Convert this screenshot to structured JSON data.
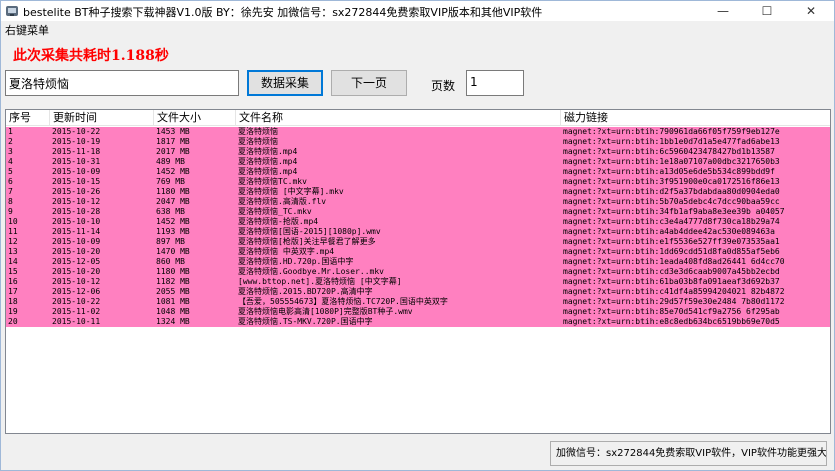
{
  "window": {
    "title": "bestelite BT种子搜索下载神器V1.0版  BY：徐先安    加微信号：sx272844免费索取VIP版本和其他VIP软件",
    "minimize_glyph": "—",
    "maximize_glyph": "☐",
    "close_glyph": "✕"
  },
  "menu": {
    "context_menu_label": "右键菜单"
  },
  "elapsed_text": "此次采集共耗时1.188秒",
  "search": {
    "value": "夏洛特烦恼"
  },
  "buttons": {
    "collect_label": "数据采集",
    "next_label": "下一页"
  },
  "page": {
    "label": "页数",
    "value": "1"
  },
  "table": {
    "row_color": "#ff80c0",
    "columns": [
      "序号",
      "更新时间",
      "文件大小",
      "文件名称",
      "磁力链接"
    ],
    "rows": [
      [
        "1",
        "2015-10-22",
        "1453 MB",
        "夏洛特烦恼",
        "magnet:?xt=urn:btih:790961da66f05f759f9eb127e"
      ],
      [
        "2",
        "2015-10-19",
        "1817 MB",
        "夏洛特烦恼",
        "magnet:?xt=urn:btih:1bb1e0d7d1a5e477fad6abe13"
      ],
      [
        "3",
        "2015-11-18",
        "2017 MB",
        "夏洛特烦恼.mp4",
        "magnet:?xt=urn:btih:6c5960423478427bd1b13587"
      ],
      [
        "4",
        "2015-10-31",
        "489 MB",
        "夏洛特烦恼.mp4",
        "magnet:?xt=urn:btih:1e18a07107a00dbc3217650b3"
      ],
      [
        "5",
        "2015-10-09",
        "1452 MB",
        "夏洛特烦恼.mp4",
        "magnet:?xt=urn:btih:a13d05e6de5b534c899bdd9f"
      ],
      [
        "6",
        "2015-10-15",
        "769 MB",
        "夏洛特烦恼TC.mkv",
        "magnet:?xt=urn:btih:3f951900e0ca0172516f86e13"
      ],
      [
        "7",
        "2015-10-26",
        "1180 MB",
        "夏洛特烦恼 [中文字幕].mkv",
        "magnet:?xt=urn:btih:d2f5a37bdabdaa80d0904eda0"
      ],
      [
        "8",
        "2015-10-12",
        "2047 MB",
        "夏洛特烦恼.高清版.flv",
        "magnet:?xt=urn:btih:5b70a5debc4c7dcc90baa59cc"
      ],
      [
        "9",
        "2015-10-28",
        "638 MB",
        "夏洛特烦恼_TC.mkv",
        "magnet:?xt=urn:btih:34fb1af9aba8e3ee39b a04057"
      ],
      [
        "10",
        "2015-10-10",
        "1452 MB",
        "夏洛特烦恼-抢版.mp4",
        "magnet:?xt=urn:btih:c3e4a4777d8f730ca18b29a74"
      ],
      [
        "11",
        "2015-11-14",
        "1193 MB",
        "夏洛特烦恼[国语-2015][1080p].wmv",
        "magnet:?xt=urn:btih:a4ab4ddee42ac530e089463a"
      ],
      [
        "12",
        "2015-10-09",
        "897 MB",
        "夏洛特烦恼[枪版]关注早餐君了解更多",
        "magnet:?xt=urn:btih:e1f5536e527ff39e073535aa1"
      ],
      [
        "13",
        "2015-10-20",
        "1470 MB",
        "夏洛特烦恼 中英双字.mp4",
        "magnet:?xt=urn:btih:1dd69cdd51d8fa0d855af5eb6"
      ],
      [
        "14",
        "2015-12-05",
        "860 MB",
        "夏洛特烦恼.HD.720p.国语中字",
        "magnet:?xt=urn:btih:1eada408fd8ad26441 6d4cc70"
      ],
      [
        "15",
        "2015-10-20",
        "1180 MB",
        "夏洛特烦恼.Goodbye.Mr.Loser..mkv",
        "magnet:?xt=urn:btih:cd3e3d6caab9007a45bb2ecbd"
      ],
      [
        "16",
        "2015-10-12",
        "1182 MB",
        "[www.bttop.net].夏洛特烦恼 [中文字幕]",
        "magnet:?xt=urn:btih:61ba03b8fa091aeaf3d692b37"
      ],
      [
        "17",
        "2015-12-06",
        "2055 MB",
        "夏洛特烦恼.2015.BD720P.高清中字",
        "magnet:?xt=urn:btih:c41df4a85994204021 82b4872"
      ],
      [
        "18",
        "2015-10-22",
        "1081 MB",
        "【吾爱，505554673】夏洛特烦恼.TC720P.国语中英双字",
        "magnet:?xt=urn:btih:29d57f59e30e2484 7b80d1172"
      ],
      [
        "19",
        "2015-11-02",
        "1048 MB",
        "夏洛特烦恼电影高清[1080P]完整版BT种子.wmv",
        "magnet:?xt=urn:btih:85e70d541cf9a2756 6f295ab"
      ],
      [
        "20",
        "2015-10-11",
        "1324 MB",
        "夏洛特烦恼.TS-MKV.720P.国语中字",
        "magnet:?xt=urn:btih:e8c8edb634bc6519bb69e70d5"
      ]
    ]
  },
  "status_text": "加微信号：sx272844免费索取VIP软件，VIP软件功能更强大"
}
